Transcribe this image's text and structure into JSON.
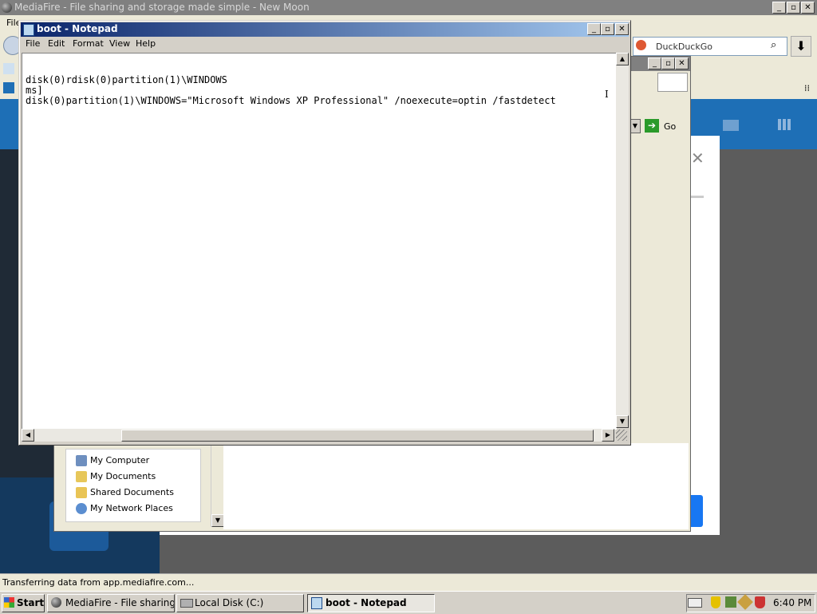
{
  "browser": {
    "title": "MediaFire - File sharing and storage made simple - New Moon",
    "menu_first": "File",
    "search_placeholder": "DuckDuckGo",
    "status_text": "Transferring data from app.mediafire.com...",
    "go_label": "Go"
  },
  "explorer": {
    "other_places": [
      "My Computer",
      "My Documents",
      "Shared Documents",
      "My Network Places"
    ]
  },
  "notepad": {
    "title": "boot - Notepad",
    "menus": [
      "File",
      "Edit",
      "Format",
      "View",
      "Help"
    ],
    "lines": [
      "disk(0)rdisk(0)partition(1)\\WINDOWS",
      "ms]",
      "disk(0)partition(1)\\WINDOWS=\"Microsoft Windows XP Professional\" /noexecute=optin /fastdetect"
    ]
  },
  "taskbar": {
    "start_label": "Start",
    "tasks": [
      "MediaFire - File sharing a...",
      "Local Disk (C:)",
      "boot - Notepad"
    ],
    "clock": "6:40 PM"
  },
  "colors": {
    "titlebar_active_start": "#0a246a",
    "titlebar_active_end": "#a6caf0",
    "mediafire_blue": "#1e6fb6",
    "desktop_gray": "#d4d0c8"
  }
}
